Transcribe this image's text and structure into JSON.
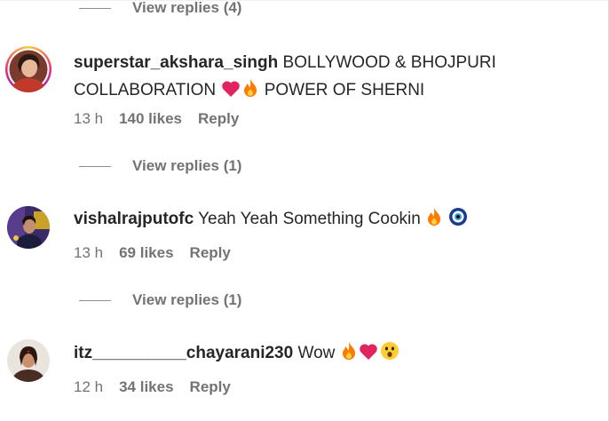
{
  "view_replies": [
    {
      "label": "View replies (4)"
    },
    {
      "label": "View replies (1)"
    },
    {
      "label": "View replies (1)"
    }
  ],
  "comments": [
    {
      "username": "superstar_akshara_singh",
      "text_part1": "BOLLYWOOD & BHOJPURI",
      "text_part2": "COLLABORATION",
      "text_part3": "POWER OF SHERNI",
      "emojis": [
        "red-heart",
        "fire"
      ],
      "time": "13 h",
      "likes": "140 likes",
      "reply": "Reply"
    },
    {
      "username": "vishalrajputofc",
      "text_part1": "Yeah Yeah Something Cookin",
      "emojis": [
        "fire",
        "nazar-amulet"
      ],
      "time": "13 h",
      "likes": "69 likes",
      "reply": "Reply"
    },
    {
      "username": "itz__________chayarani230",
      "text_part1": "Wow",
      "emojis": [
        "fire",
        "red-heart",
        "astonished-face"
      ],
      "time": "12 h",
      "likes": "34 likes",
      "reply": "Reply"
    }
  ],
  "colors": {
    "text": "#262626",
    "secondary": "#737373",
    "fire": "#ff7a00",
    "heart": "#e0245e"
  }
}
